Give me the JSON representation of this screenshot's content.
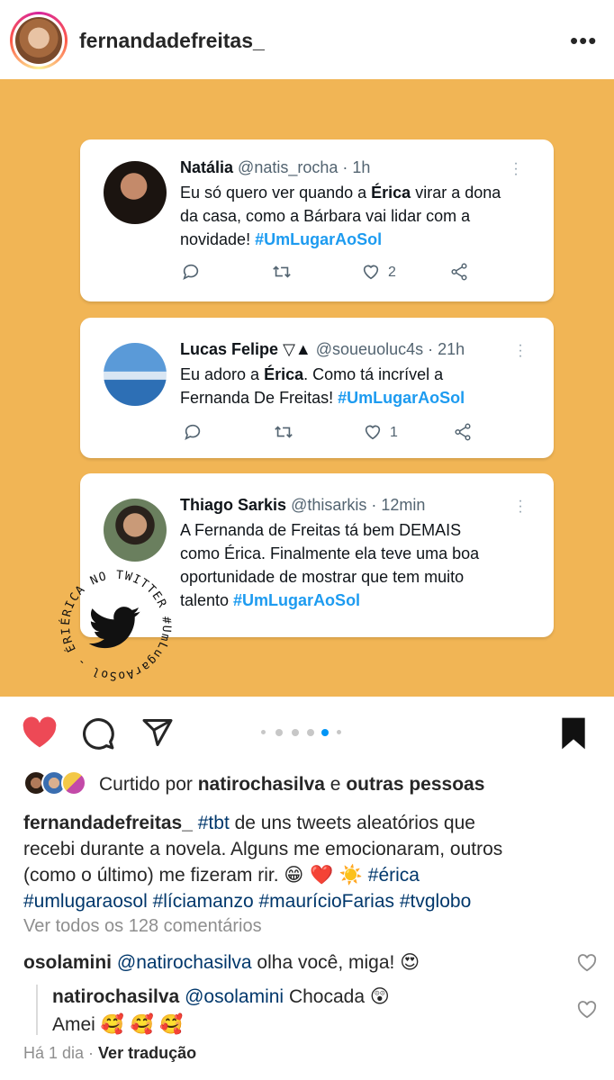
{
  "header": {
    "username": "fernandadefreitas_",
    "more_label": "•••"
  },
  "tweets": [
    {
      "name": "Natália",
      "handle": "@natis_rocha · 1h",
      "line1_pre": "Eu só quero ver quando a ",
      "line1_bold": "Érica",
      "line1_post": " virar a dona",
      "line2": "da casa, como a Bárbara vai lidar com a",
      "line3_pre": "novidade!  ",
      "hashtag": "#UmLugarAoSol",
      "like_count": "2"
    },
    {
      "name": "Lucas Felipe",
      "name_symbols": "▽▲",
      "handle": "@soueuoluc4s · 21h",
      "line1_pre": "Eu adoro a ",
      "line1_bold": "Érica",
      "line1_post": ". Como tá incrível a",
      "line2_pre": "Fernanda De Freitas! ",
      "hashtag": "#UmLugarAoSol",
      "like_count": "1"
    },
    {
      "name": "Thiago Sarkis",
      "handle": "@thisarkis · 12min",
      "line1": "A Fernanda de Freitas tá bem DEMAIS",
      "line2": "como Érica. Finalmente ela teve uma boa",
      "line3": "oportunidade de mostrar que tem muito",
      "line4_pre": "talento ",
      "hashtag": "#UmLugarAoSol"
    }
  ],
  "badge": {
    "ring_text": "ÉRICA NO TWITTER #UmLugarAoSol - ÉRICA NO TWITTER"
  },
  "likes": {
    "prefix": "Curtido por ",
    "user": "natirochasilva",
    "middle": " e ",
    "others": "outras pessoas"
  },
  "caption": {
    "user": "fernandadefreitas_",
    "tag_tbt": "#tbt",
    "text1": " de uns tweets aleatórios que",
    "text2": "recebi durante a novela. Alguns me emocionaram, outros",
    "text3": "(como o último) me fizeram rir. ",
    "emojis": "😁 ❤️ ☀️",
    "tag_erica": "#érica",
    "tags_line": "#umlugaraosol #líciamanzo #maurícioFarias #tvglobo"
  },
  "comments": {
    "view_all": "Ver todos os 128 comentários",
    "c1_user": "osolamini",
    "c1_mention": "@natirochasilva",
    "c1_text": " olha você, miga! ",
    "c1_emoji": "😍",
    "c2_user": "natirochasilva",
    "c2_mention": "@osolamini",
    "c2_text": " Chocada ",
    "c2_emoji": "😲",
    "c2_line2": "Amei ",
    "c2_line2_emoji": "🥰 🥰 🥰"
  },
  "footer": {
    "time": "Há 1 dia",
    "sep": " · ",
    "translate": "Ver tradução"
  },
  "colors": {
    "post_bg": "#f1b555",
    "like_red": "#ed4956",
    "hashtag_blue": "#1d9bf0",
    "ig_link": "#00376b"
  }
}
